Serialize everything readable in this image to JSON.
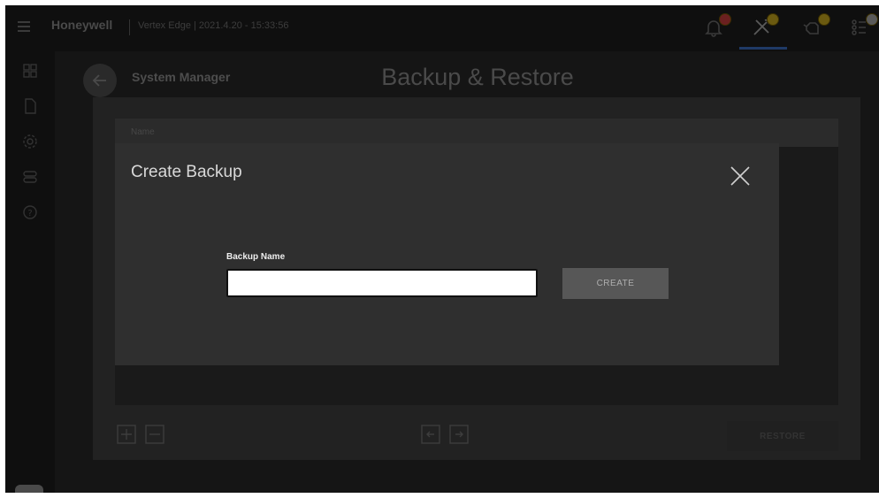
{
  "header": {
    "brand": "Honeywell",
    "app_info": "Vertex Edge | 2021.4.20 - 15:33:56",
    "icons": [
      "bell-icon",
      "tools-icon",
      "hand-icon",
      "list-settings-icon"
    ]
  },
  "sidebar": {
    "icons": [
      "dashboard-icon",
      "document-icon",
      "gear-icon",
      "toggle-icon",
      "help-icon"
    ],
    "avatar": "Adm"
  },
  "page": {
    "breadcrumb": "System Manager",
    "title": "Backup & Restore",
    "table": {
      "columns": [
        "Name"
      ]
    },
    "restore_label": "RESTORE"
  },
  "dialog": {
    "title": "Create Backup",
    "field_label": "Backup Name",
    "field_value": "",
    "create_label": "CREATE"
  },
  "colors": {
    "background": "#151515",
    "dialog": "#2f2f2f",
    "accent_underline": "#1f3a66"
  }
}
